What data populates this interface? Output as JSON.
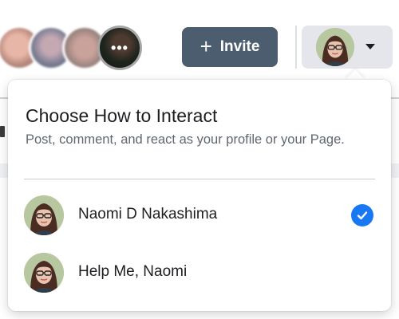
{
  "header": {
    "invite_label": "Invite",
    "members": [
      {
        "icon": "member-avatar-blurred"
      },
      {
        "icon": "member-avatar-blurred"
      },
      {
        "icon": "member-avatar-blurred"
      },
      {
        "icon": "member-avatar-photo"
      }
    ],
    "more_members_label": "•••"
  },
  "account_switcher": {
    "avatar_icon": "profile-avatar",
    "caret_icon": "caret-down-icon"
  },
  "dropdown": {
    "title": "Choose How to Interact",
    "subtitle": "Post, comment, and react as your profile or your Page.",
    "options": [
      {
        "label": "Naomi D Nakashima",
        "selected": true
      },
      {
        "label": "Help Me, Naomi",
        "selected": false
      }
    ]
  },
  "colors": {
    "invite_button": "#4b5d6e",
    "check_badge": "#1877f2",
    "switcher_bg": "#e4e6eb"
  }
}
